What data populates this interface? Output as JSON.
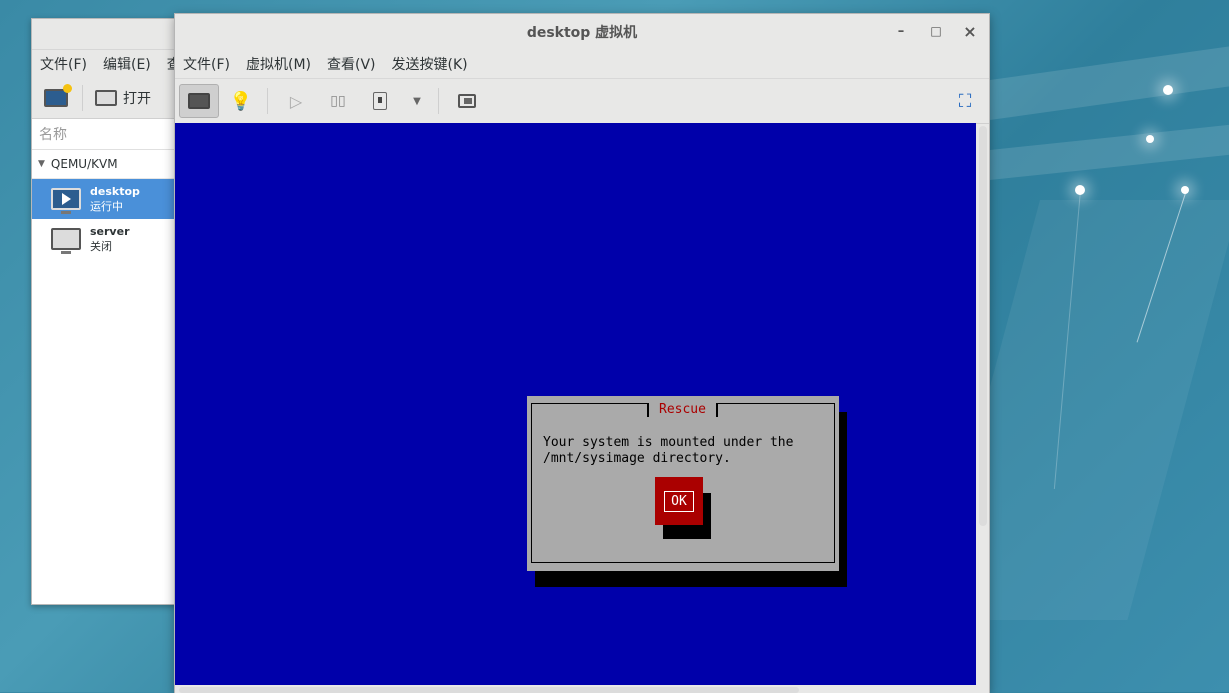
{
  "manager": {
    "menu": [
      "文件(F)",
      "编辑(E)",
      "查"
    ],
    "toolbar_open_label": "打开",
    "list_header": "名称",
    "group_label": "QEMU/KVM",
    "vms": [
      {
        "name": "desktop",
        "status": "运行中"
      },
      {
        "name": "server",
        "status": "关闭"
      }
    ]
  },
  "vm_window": {
    "title": "desktop 虚拟机",
    "menu": [
      "文件(F)",
      "虚拟机(M)",
      "查看(V)",
      "发送按键(K)"
    ],
    "window_buttons": {
      "minimize": "–",
      "maximize": "□",
      "close": "×"
    }
  },
  "rescue_dialog": {
    "title": "Rescue",
    "message": "Your system is mounted under the\n/mnt/sysimage directory.",
    "ok_label": "OK"
  },
  "colors": {
    "console_bg": "#0000aa",
    "dialog_bg": "#aaaaaa",
    "dialog_title": "#aa0000",
    "ok_bg": "#aa0000",
    "selection": "#4a90d9"
  },
  "icons": [
    "new-vm-icon",
    "monitor-icon",
    "lightbulb-icon",
    "play-icon",
    "pause-icon",
    "power-icon",
    "chevron-down-icon",
    "snapshot-icon",
    "fullscreen-icon"
  ]
}
